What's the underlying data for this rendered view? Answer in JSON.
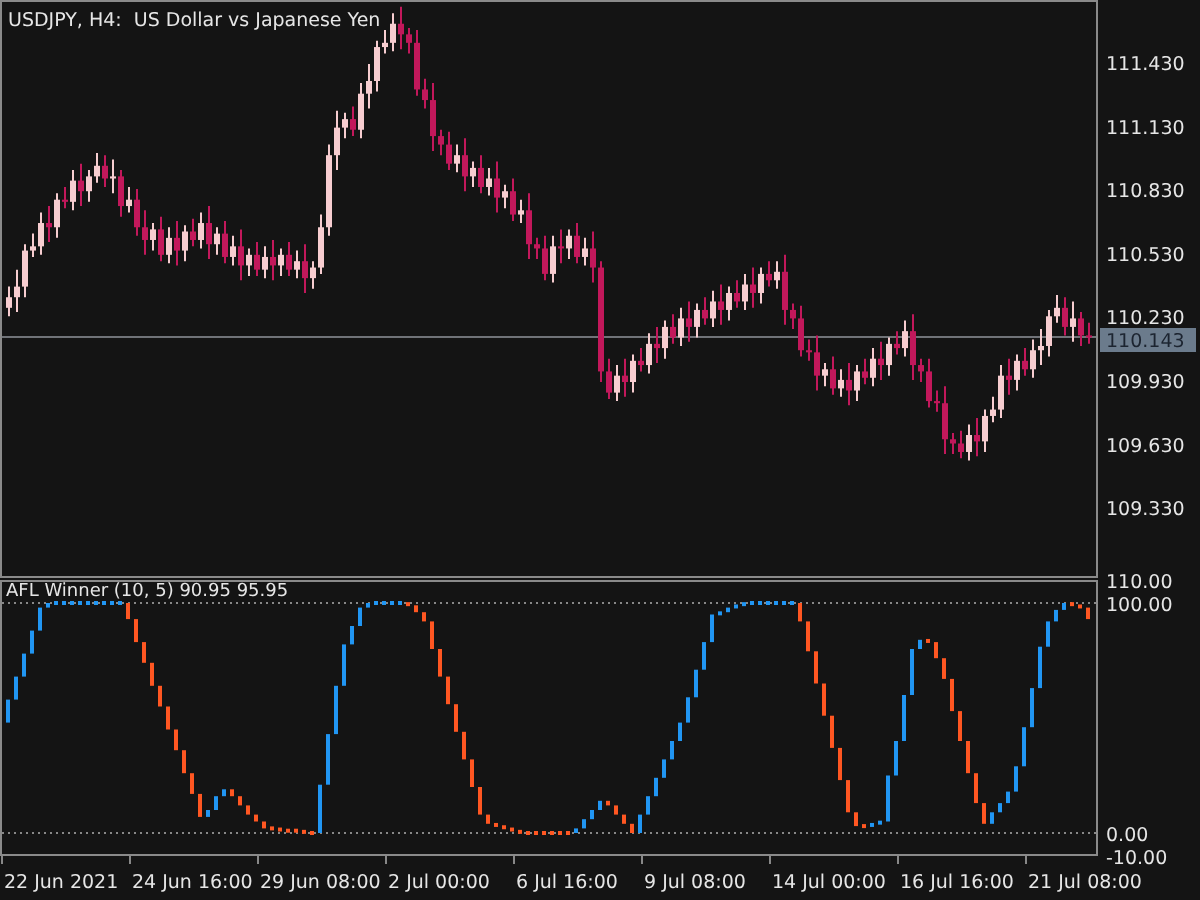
{
  "price_chart": {
    "chart_data": {
      "type": "candlestick",
      "title": "USDJPY, H4:  US Dollar vs Japanese Yen",
      "ylim": [
        109.015,
        111.732
      ],
      "yticks": [
        {
          "value": 111.43,
          "label": "111.430"
        },
        {
          "value": 111.13,
          "label": "111.130"
        },
        {
          "value": 110.83,
          "label": "110.830"
        },
        {
          "value": 110.53,
          "label": "110.530"
        },
        {
          "value": 110.23,
          "label": "110.230"
        },
        {
          "value": 109.93,
          "label": "109.930"
        },
        {
          "value": 109.63,
          "label": "109.630"
        },
        {
          "value": 109.33,
          "label": "109.330"
        }
      ],
      "ohlc": [
        [
          110.28,
          110.38,
          110.24,
          110.33
        ],
        [
          110.33,
          110.46,
          110.26,
          110.38
        ],
        [
          110.38,
          110.58,
          110.33,
          110.55
        ],
        [
          110.55,
          110.63,
          110.52,
          110.57
        ],
        [
          110.57,
          110.73,
          110.53,
          110.68
        ],
        [
          110.68,
          110.76,
          110.59,
          110.66
        ],
        [
          110.66,
          110.82,
          110.61,
          110.79
        ],
        [
          110.79,
          110.85,
          110.75,
          110.78
        ],
        [
          110.78,
          110.93,
          110.74,
          110.88
        ],
        [
          110.88,
          110.96,
          110.76,
          110.83
        ],
        [
          110.83,
          110.93,
          110.78,
          110.9
        ],
        [
          110.9,
          111.01,
          110.87,
          110.95
        ],
        [
          110.95,
          111.0,
          110.85,
          110.89
        ],
        [
          110.89,
          110.98,
          110.82,
          110.9
        ],
        [
          110.9,
          110.93,
          110.71,
          110.76
        ],
        [
          110.76,
          110.85,
          110.73,
          110.79
        ],
        [
          110.79,
          110.84,
          110.62,
          110.66
        ],
        [
          110.66,
          110.74,
          110.53,
          110.6
        ],
        [
          110.6,
          110.68,
          110.55,
          110.65
        ],
        [
          110.65,
          110.71,
          110.5,
          110.53
        ],
        [
          110.53,
          110.66,
          110.49,
          110.61
        ],
        [
          110.61,
          110.69,
          110.48,
          110.55
        ],
        [
          110.55,
          110.67,
          110.5,
          110.64
        ],
        [
          110.64,
          110.7,
          110.57,
          110.6
        ],
        [
          110.6,
          110.73,
          110.56,
          110.68
        ],
        [
          110.68,
          110.76,
          110.51,
          110.58
        ],
        [
          110.58,
          110.66,
          110.53,
          110.63
        ],
        [
          110.63,
          110.69,
          110.49,
          110.52
        ],
        [
          110.52,
          110.62,
          110.48,
          110.57
        ],
        [
          110.57,
          110.65,
          110.41,
          110.48
        ],
        [
          110.48,
          110.56,
          110.43,
          110.53
        ],
        [
          110.53,
          110.59,
          110.43,
          110.46
        ],
        [
          110.46,
          110.57,
          110.42,
          110.52
        ],
        [
          110.52,
          110.6,
          110.41,
          110.48
        ],
        [
          110.48,
          110.56,
          110.43,
          110.53
        ],
        [
          110.53,
          110.59,
          110.43,
          110.46
        ],
        [
          110.46,
          110.55,
          110.42,
          110.5
        ],
        [
          110.5,
          110.58,
          110.35,
          110.42
        ],
        [
          110.42,
          110.5,
          110.37,
          110.47
        ],
        [
          110.47,
          110.72,
          110.44,
          110.66
        ],
        [
          110.66,
          111.05,
          110.62,
          111.0
        ],
        [
          111.0,
          111.21,
          110.93,
          111.13
        ],
        [
          111.13,
          111.2,
          111.08,
          111.17
        ],
        [
          111.17,
          111.23,
          111.09,
          111.12
        ],
        [
          111.12,
          111.34,
          111.08,
          111.29
        ],
        [
          111.29,
          111.43,
          111.22,
          111.35
        ],
        [
          111.35,
          111.54,
          111.3,
          111.51
        ],
        [
          111.51,
          111.59,
          111.48,
          111.53
        ],
        [
          111.53,
          111.67,
          111.49,
          111.62
        ],
        [
          111.62,
          111.7,
          111.5,
          111.57
        ],
        [
          111.57,
          111.6,
          111.48,
          111.53
        ],
        [
          111.53,
          111.59,
          111.28,
          111.31
        ],
        [
          111.31,
          111.36,
          111.22,
          111.26
        ],
        [
          111.26,
          111.34,
          111.02,
          111.09
        ],
        [
          111.09,
          111.12,
          111.0,
          111.05
        ],
        [
          111.05,
          111.11,
          110.93,
          110.96
        ],
        [
          110.96,
          111.05,
          110.92,
          111.0
        ],
        [
          111.0,
          111.08,
          110.83,
          110.9
        ],
        [
          110.9,
          110.97,
          110.85,
          110.94
        ],
        [
          110.94,
          111.0,
          110.82,
          110.85
        ],
        [
          110.85,
          110.94,
          110.81,
          110.89
        ],
        [
          110.89,
          110.97,
          110.73,
          110.8
        ],
        [
          110.8,
          110.86,
          110.75,
          110.83
        ],
        [
          110.83,
          110.89,
          110.69,
          110.72
        ],
        [
          110.72,
          110.79,
          110.68,
          110.74
        ],
        [
          110.74,
          110.82,
          110.51,
          110.58
        ],
        [
          110.58,
          110.61,
          110.51,
          110.56
        ],
        [
          110.56,
          110.62,
          110.41,
          110.44
        ],
        [
          110.44,
          110.62,
          110.4,
          110.57
        ],
        [
          110.57,
          110.65,
          110.49,
          110.56
        ],
        [
          110.56,
          110.65,
          110.51,
          110.62
        ],
        [
          110.62,
          110.68,
          110.49,
          110.52
        ],
        [
          110.52,
          110.61,
          110.48,
          110.56
        ],
        [
          110.56,
          110.64,
          110.4,
          110.47
        ],
        [
          110.47,
          110.5,
          109.93,
          109.98
        ],
        [
          109.98,
          110.04,
          109.85,
          109.88
        ],
        [
          109.88,
          110.01,
          109.84,
          109.96
        ],
        [
          109.96,
          110.04,
          109.86,
          109.93
        ],
        [
          109.93,
          110.06,
          109.88,
          110.03
        ],
        [
          110.03,
          110.09,
          109.98,
          110.01
        ],
        [
          110.01,
          110.16,
          109.97,
          110.11
        ],
        [
          110.11,
          110.19,
          110.02,
          110.09
        ],
        [
          110.09,
          110.22,
          110.04,
          110.19
        ],
        [
          110.19,
          110.25,
          110.11,
          110.14
        ],
        [
          110.14,
          110.28,
          110.1,
          110.23
        ],
        [
          110.23,
          110.31,
          110.12,
          110.19
        ],
        [
          110.19,
          110.3,
          110.14,
          110.27
        ],
        [
          110.27,
          110.33,
          110.2,
          110.23
        ],
        [
          110.23,
          110.36,
          110.19,
          110.31
        ],
        [
          110.31,
          110.39,
          110.2,
          110.27
        ],
        [
          110.27,
          110.38,
          110.22,
          110.35
        ],
        [
          110.35,
          110.41,
          110.28,
          110.31
        ],
        [
          110.31,
          110.44,
          110.27,
          110.39
        ],
        [
          110.39,
          110.47,
          110.28,
          110.35
        ],
        [
          110.35,
          110.47,
          110.3,
          110.44
        ],
        [
          110.44,
          110.5,
          110.38,
          110.41
        ],
        [
          110.41,
          110.5,
          110.37,
          110.45
        ],
        [
          110.45,
          110.53,
          110.2,
          110.27
        ],
        [
          110.27,
          110.3,
          110.18,
          110.23
        ],
        [
          110.23,
          110.29,
          110.05,
          110.08
        ],
        [
          110.08,
          110.13,
          110.03,
          110.07
        ],
        [
          110.07,
          110.15,
          109.89,
          109.96
        ],
        [
          109.96,
          110.02,
          109.91,
          109.99
        ],
        [
          109.99,
          110.05,
          109.87,
          109.9
        ],
        [
          109.9,
          109.99,
          109.86,
          109.94
        ],
        [
          109.94,
          110.02,
          109.82,
          109.89
        ],
        [
          109.89,
          110.01,
          109.84,
          109.98
        ],
        [
          109.98,
          110.04,
          109.92,
          109.95
        ],
        [
          109.95,
          110.09,
          109.91,
          110.04
        ],
        [
          110.04,
          110.12,
          109.94,
          110.01
        ],
        [
          110.01,
          110.14,
          109.96,
          110.11
        ],
        [
          110.11,
          110.17,
          110.06,
          110.09
        ],
        [
          110.09,
          110.22,
          110.05,
          110.17
        ],
        [
          110.17,
          110.25,
          109.94,
          110.01
        ],
        [
          110.01,
          110.04,
          109.93,
          109.98
        ],
        [
          109.98,
          110.04,
          109.81,
          109.84
        ],
        [
          109.84,
          109.89,
          109.79,
          109.83
        ],
        [
          109.83,
          109.91,
          109.59,
          109.66
        ],
        [
          109.66,
          109.69,
          109.59,
          109.64
        ],
        [
          109.64,
          109.7,
          109.57,
          109.6
        ],
        [
          109.6,
          109.73,
          109.56,
          109.68
        ],
        [
          109.68,
          109.76,
          109.58,
          109.65
        ],
        [
          109.65,
          109.8,
          109.6,
          109.77
        ],
        [
          109.77,
          109.86,
          109.74,
          109.8
        ],
        [
          109.8,
          110.01,
          109.76,
          109.96
        ],
        [
          109.96,
          110.04,
          109.87,
          109.94
        ],
        [
          109.94,
          110.06,
          109.89,
          110.03
        ],
        [
          110.03,
          110.09,
          109.96,
          109.99
        ],
        [
          109.99,
          110.13,
          109.95,
          110.08
        ],
        [
          110.08,
          110.18,
          110.01,
          110.1
        ],
        [
          110.1,
          110.27,
          110.05,
          110.24
        ],
        [
          110.24,
          110.34,
          110.21,
          110.28
        ],
        [
          110.28,
          110.33,
          110.15,
          110.19
        ],
        [
          110.19,
          110.31,
          110.12,
          110.23
        ],
        [
          110.23,
          110.26,
          110.1,
          110.15
        ],
        [
          110.15,
          110.21,
          110.11,
          110.14
        ]
      ]
    },
    "current_price": "110.143"
  },
  "time_axis": {
    "labels": [
      "22 Jun 2021",
      "24 Jun 16:00",
      "29 Jun 08:00",
      "2 Jul 00:00",
      "6 Jul 16:00",
      "9 Jul 08:00",
      "14 Jul 00:00",
      "16 Jul 16:00",
      "21 Jul 08:00"
    ]
  },
  "indicator": {
    "chart_data": {
      "type": "candlestick",
      "title": "AFL Winner (10, 5) 90.95 95.95",
      "ylim": [
        -10,
        110
      ],
      "yticks": [
        {
          "value": 110,
          "label": "110.00"
        },
        {
          "value": 100,
          "label": "100.00"
        },
        {
          "value": 0,
          "label": "0.00"
        },
        {
          "value": -10,
          "label": "-10.00"
        }
      ],
      "ohlc": [
        [
          48,
          58,
          48,
          58
        ],
        [
          58,
          68,
          58,
          68
        ],
        [
          68,
          78,
          68,
          78
        ],
        [
          78,
          88,
          78,
          88
        ],
        [
          88,
          98,
          88,
          98
        ],
        [
          98,
          100,
          98,
          100
        ],
        [
          100,
          100,
          100,
          100
        ],
        [
          100,
          100,
          100,
          100
        ],
        [
          100,
          100,
          100,
          100
        ],
        [
          100,
          100,
          100,
          100
        ],
        [
          100,
          100,
          100,
          100
        ],
        [
          100,
          100,
          100,
          100
        ],
        [
          100,
          100,
          100,
          100
        ],
        [
          100,
          100,
          100,
          100
        ],
        [
          100,
          100,
          100,
          100
        ],
        [
          100,
          100,
          93,
          93
        ],
        [
          93,
          93,
          83,
          83
        ],
        [
          83,
          83,
          74,
          74
        ],
        [
          74,
          74,
          64,
          64
        ],
        [
          64,
          64,
          55,
          55
        ],
        [
          55,
          55,
          45,
          45
        ],
        [
          45,
          45,
          36,
          36
        ],
        [
          36,
          36,
          26,
          26
        ],
        [
          26,
          26,
          17,
          17
        ],
        [
          17,
          17,
          7,
          7
        ],
        [
          7,
          10,
          7,
          10
        ],
        [
          10,
          16,
          10,
          16
        ],
        [
          16,
          19,
          16,
          19
        ],
        [
          19,
          19,
          16,
          16
        ],
        [
          16,
          16,
          12,
          12
        ],
        [
          12,
          12,
          8,
          8
        ],
        [
          8,
          8,
          5,
          5
        ],
        [
          5,
          5,
          2,
          2
        ],
        [
          2,
          2,
          2,
          2
        ],
        [
          2,
          2,
          1,
          1
        ],
        [
          1,
          1,
          1,
          1
        ],
        [
          1,
          1,
          1,
          1
        ],
        [
          1,
          1,
          0,
          0
        ],
        [
          0,
          0,
          0,
          0
        ],
        [
          0,
          21,
          0,
          21
        ],
        [
          21,
          43,
          21,
          43
        ],
        [
          43,
          64,
          43,
          64
        ],
        [
          64,
          82,
          64,
          82
        ],
        [
          82,
          90,
          82,
          90
        ],
        [
          90,
          98,
          90,
          98
        ],
        [
          98,
          100,
          98,
          100
        ],
        [
          100,
          100,
          100,
          100
        ],
        [
          100,
          100,
          100,
          100
        ],
        [
          100,
          100,
          100,
          100
        ],
        [
          100,
          100,
          100,
          100
        ],
        [
          100,
          100,
          99,
          99
        ],
        [
          99,
          99,
          96,
          96
        ],
        [
          96,
          96,
          92,
          92
        ],
        [
          92,
          92,
          80,
          80
        ],
        [
          80,
          80,
          68,
          68
        ],
        [
          68,
          68,
          56,
          56
        ],
        [
          56,
          56,
          44,
          44
        ],
        [
          44,
          44,
          32,
          32
        ],
        [
          32,
          32,
          20,
          20
        ],
        [
          20,
          20,
          8,
          8
        ],
        [
          8,
          8,
          4,
          4
        ],
        [
          4,
          4,
          3,
          3
        ],
        [
          3,
          3,
          2,
          2
        ],
        [
          2,
          2,
          1,
          1
        ],
        [
          1,
          1,
          0,
          0
        ],
        [
          0,
          0,
          0,
          0
        ],
        [
          0,
          0,
          0,
          0
        ],
        [
          0,
          0,
          0,
          0
        ],
        [
          0,
          0,
          0,
          0
        ],
        [
          0,
          0,
          0,
          0
        ],
        [
          0,
          0,
          0,
          0
        ],
        [
          0,
          2,
          0,
          2
        ],
        [
          2,
          6,
          2,
          6
        ],
        [
          6,
          10,
          6,
          10
        ],
        [
          10,
          14,
          10,
          14
        ],
        [
          14,
          14,
          12,
          12
        ],
        [
          12,
          12,
          8,
          8
        ],
        [
          8,
          8,
          4,
          4
        ],
        [
          4,
          4,
          0,
          0
        ],
        [
          0,
          8,
          0,
          8
        ],
        [
          8,
          16,
          8,
          16
        ],
        [
          16,
          24,
          16,
          24
        ],
        [
          24,
          32,
          24,
          32
        ],
        [
          32,
          40,
          32,
          40
        ],
        [
          40,
          48,
          40,
          48
        ],
        [
          48,
          59,
          48,
          59
        ],
        [
          59,
          71,
          59,
          71
        ],
        [
          71,
          83,
          71,
          83
        ],
        [
          83,
          95,
          83,
          95
        ],
        [
          95,
          96,
          95,
          96
        ],
        [
          96,
          98,
          96,
          98
        ],
        [
          98,
          99,
          98,
          99
        ],
        [
          99,
          100,
          99,
          100
        ],
        [
          100,
          100,
          100,
          100
        ],
        [
          100,
          100,
          100,
          100
        ],
        [
          100,
          100,
          100,
          100
        ],
        [
          100,
          100,
          100,
          100
        ],
        [
          100,
          100,
          100,
          100
        ],
        [
          100,
          100,
          100,
          100
        ],
        [
          100,
          100,
          92,
          92
        ],
        [
          92,
          92,
          79,
          79
        ],
        [
          79,
          79,
          65,
          65
        ],
        [
          65,
          65,
          51,
          51
        ],
        [
          51,
          51,
          37,
          37
        ],
        [
          37,
          37,
          23,
          23
        ],
        [
          23,
          23,
          9,
          9
        ],
        [
          9,
          9,
          3,
          3
        ],
        [
          3,
          3,
          3,
          3
        ],
        [
          3,
          4,
          3,
          4
        ],
        [
          4,
          5,
          4,
          5
        ],
        [
          5,
          25,
          5,
          25
        ],
        [
          25,
          40,
          25,
          40
        ],
        [
          40,
          60,
          40,
          60
        ],
        [
          60,
          80,
          60,
          80
        ],
        [
          80,
          84,
          80,
          84
        ],
        [
          84,
          84,
          83,
          83
        ],
        [
          83,
          83,
          76,
          76
        ],
        [
          76,
          76,
          67,
          67
        ],
        [
          67,
          67,
          53,
          53
        ],
        [
          53,
          53,
          40,
          40
        ],
        [
          40,
          40,
          26,
          26
        ],
        [
          26,
          26,
          13,
          13
        ],
        [
          13,
          13,
          4,
          4
        ],
        [
          4,
          9,
          4,
          9
        ],
        [
          9,
          13,
          9,
          13
        ],
        [
          13,
          18,
          13,
          18
        ],
        [
          18,
          29,
          18,
          29
        ],
        [
          29,
          46,
          29,
          46
        ],
        [
          46,
          63,
          46,
          63
        ],
        [
          63,
          81,
          63,
          81
        ],
        [
          81,
          92,
          81,
          92
        ],
        [
          92,
          97,
          92,
          97
        ],
        [
          97,
          100,
          97,
          100
        ],
        [
          100,
          100,
          99,
          99
        ],
        [
          99,
          99,
          98,
          98
        ],
        [
          98,
          98,
          93,
          93
        ]
      ]
    }
  }
}
